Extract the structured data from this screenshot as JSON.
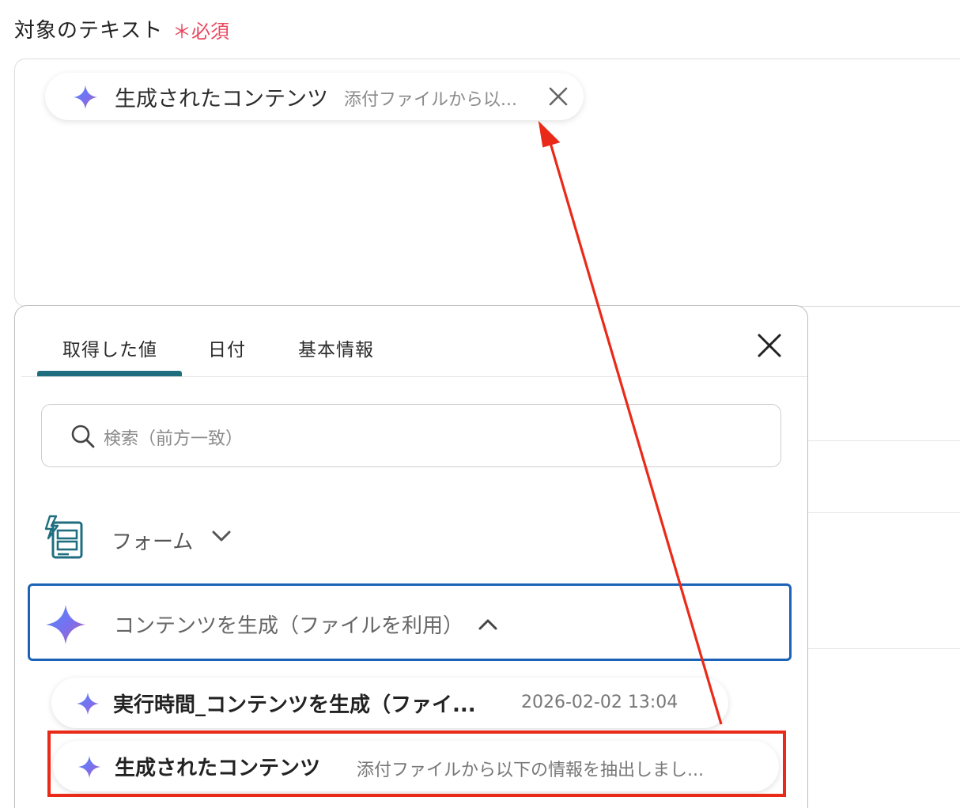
{
  "field": {
    "label": "対象のテキスト",
    "required": "＊必須"
  },
  "chip": {
    "title": "生成されたコンテンツ",
    "subtitle": "添付ファイルから以..."
  },
  "panel": {
    "tabs": [
      {
        "label": "取得した値",
        "active": true
      },
      {
        "label": "日付",
        "active": false
      },
      {
        "label": "基本情報",
        "active": false
      }
    ],
    "search": {
      "placeholder": "検索（前方一致）"
    },
    "groups": [
      {
        "label": "フォーム",
        "expanded": false
      },
      {
        "label": "コンテンツを生成（ファイルを利用）",
        "expanded": true
      }
    ],
    "items": [
      {
        "title": "実行時間_コンテンツを生成（ファイ...",
        "subtitle": "2026-02-02 13:04"
      },
      {
        "title": "生成されたコンテンツ",
        "subtitle": "添付ファイルから以下の情報を抽出しまし..."
      }
    ]
  },
  "colors": {
    "accent": "#1f6e80",
    "required": "#e8485f",
    "highlight": "#ea2a19",
    "selected_border": "#1c63b7"
  },
  "icons": [
    "sparkle-icon",
    "close-icon",
    "search-icon",
    "form-icon",
    "chevron-down-icon",
    "chevron-up-icon"
  ]
}
